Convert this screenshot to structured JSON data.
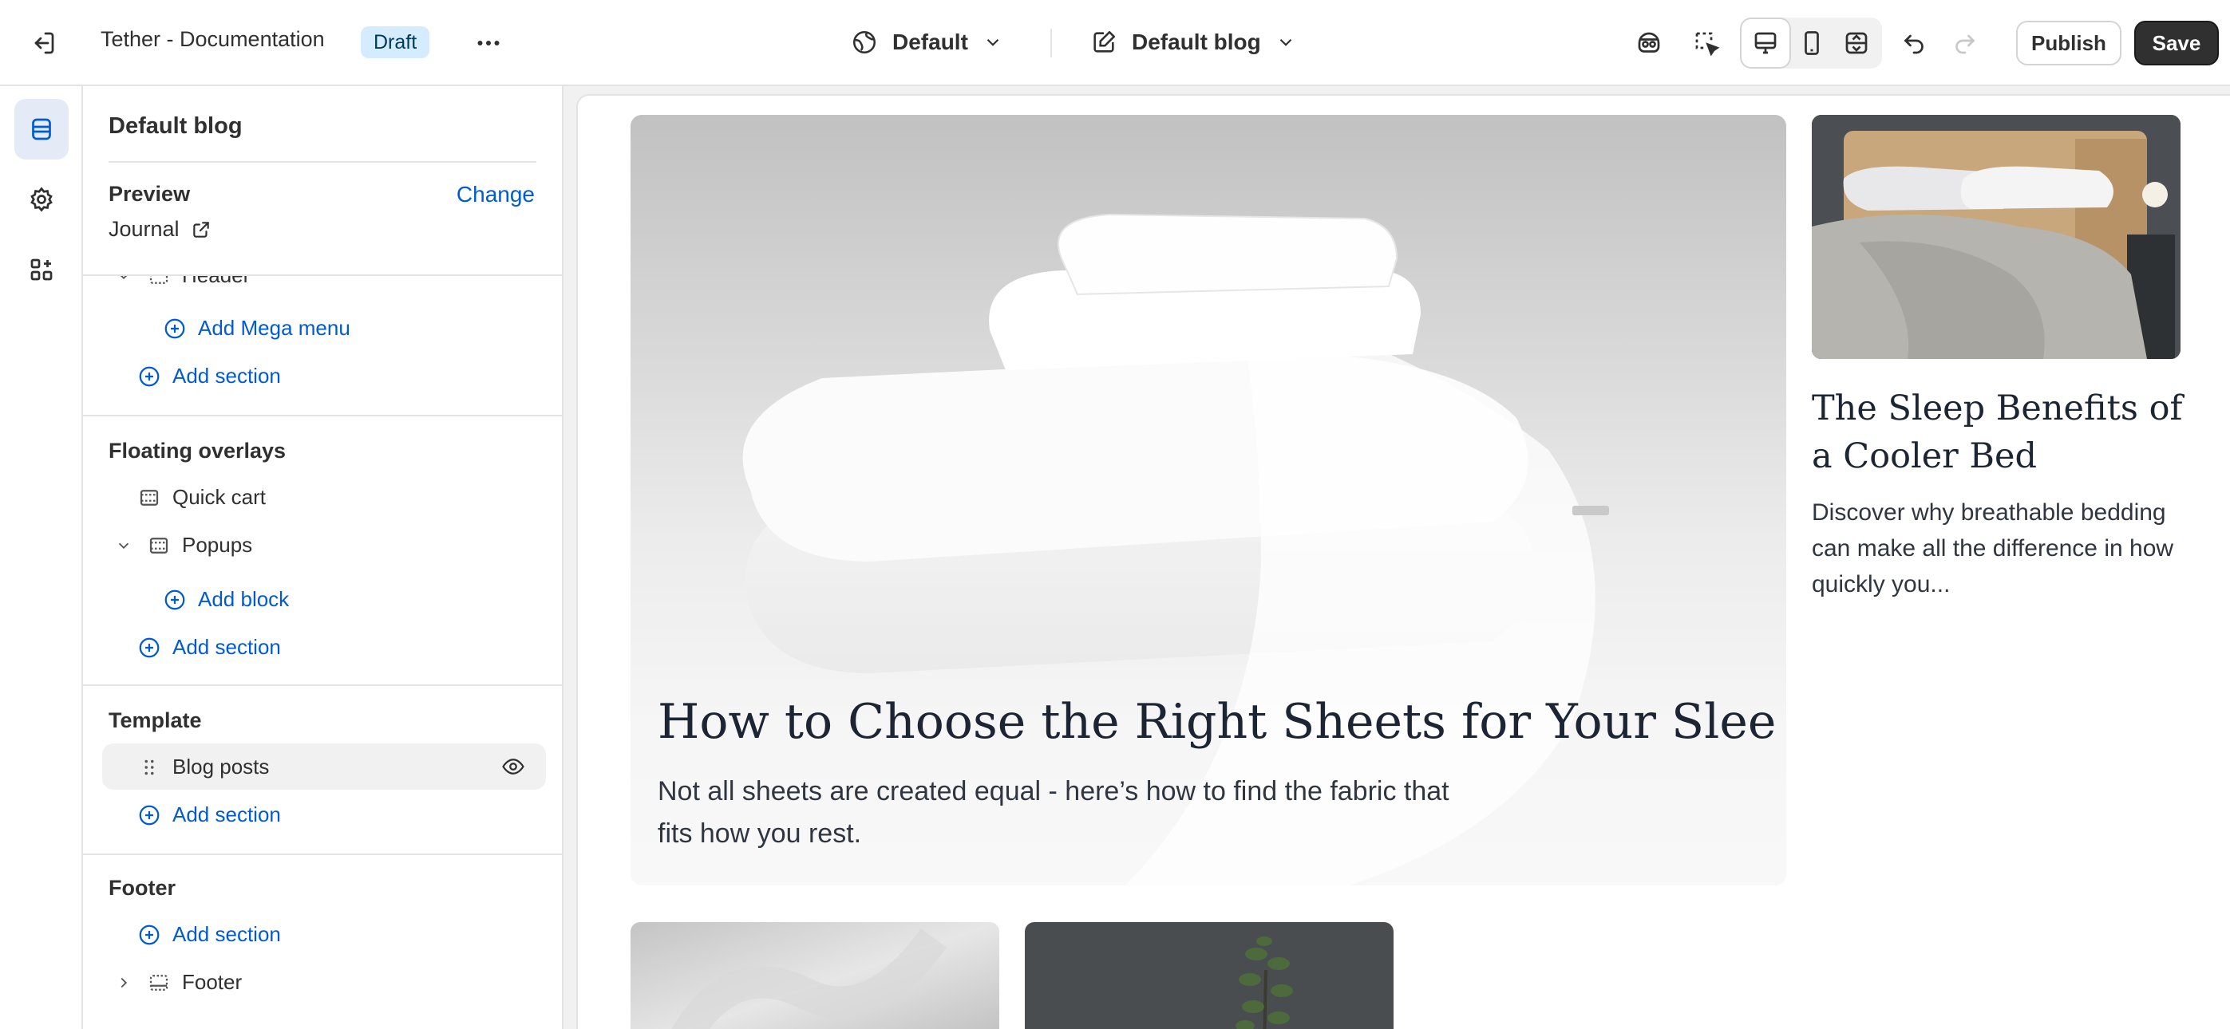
{
  "topbar": {
    "store_title": "Tether - Documentation",
    "status_badge": "Draft",
    "theme_select": "Default",
    "template_select": "Default blog",
    "publish_label": "Publish",
    "save_label": "Save",
    "icons": [
      "exit-icon",
      "more-icon",
      "globe-icon",
      "edit-template-icon",
      "inspector-icon",
      "select-element-icon",
      "desktop-icon",
      "mobile-icon",
      "fullwidth-icon",
      "undo-icon",
      "redo-icon"
    ]
  },
  "rail": {
    "items": [
      {
        "icon": "sections-icon",
        "active": true
      },
      {
        "icon": "settings-icon",
        "active": false
      },
      {
        "icon": "apps-icon",
        "active": false
      }
    ]
  },
  "sidebar": {
    "title": "Default blog",
    "preview": {
      "label": "Preview",
      "change": "Change",
      "value": "Journal"
    },
    "header_group": {
      "partial_item": "Header",
      "add_mega_menu": "Add Mega menu",
      "add_section": "Add section"
    },
    "floating_overlays": {
      "title": "Floating overlays",
      "items": [
        "Quick cart",
        "Popups"
      ],
      "add_block": "Add block",
      "add_section": "Add section"
    },
    "template": {
      "title": "Template",
      "item": "Blog posts",
      "add_section": "Add section"
    },
    "footer": {
      "title": "Footer",
      "add_section": "Add section",
      "item": "Footer"
    }
  },
  "preview_page": {
    "hero": {
      "title": "How to Choose the Right Sheets for Your Sleep S...",
      "excerpt": "Not all sheets are created equal - here’s how to find the fabric that fits how you rest."
    },
    "side_post": {
      "title": "The Sleep Benefits of a Cooler Bed",
      "excerpt": "Discover why breathable bedding can make all the difference in how quickly you..."
    }
  },
  "colors": {
    "accent": "#005bd3",
    "badge_bg": "#d5ebff",
    "save_bg": "#303030",
    "border": "#e3e3e3"
  }
}
